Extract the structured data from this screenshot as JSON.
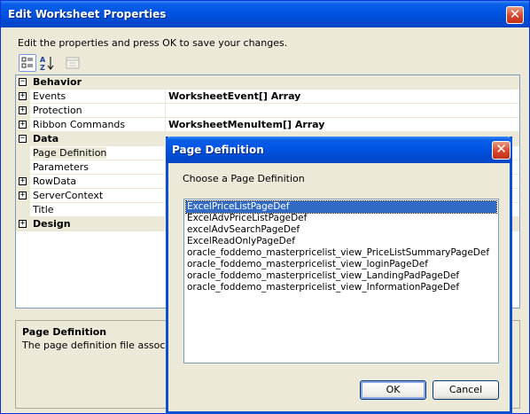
{
  "window": {
    "title": "Edit Worksheet Properties",
    "description": "Edit the properties and press OK to save your changes.",
    "close_glyph": "✕"
  },
  "toolbar": {
    "categorized_icon": "categorized-icon",
    "alphabetical_icon": "sort-alphabetical-icon",
    "property_pages_icon": "property-pages-icon"
  },
  "grid": {
    "rows": [
      {
        "kind": "category",
        "expander": "⊟",
        "name": "Behavior",
        "value": ""
      },
      {
        "kind": "property",
        "expander": "+",
        "name": "Events",
        "value": "WorksheetEvent[] Array"
      },
      {
        "kind": "property",
        "expander": "+",
        "name": "Protection",
        "value": ""
      },
      {
        "kind": "property",
        "expander": "+",
        "name": "Ribbon Commands",
        "value": "WorksheetMenuItem[] Array"
      },
      {
        "kind": "category",
        "expander": "⊟",
        "name": "Data",
        "value": ""
      },
      {
        "kind": "property",
        "expander": "",
        "name": "Page Definition",
        "value": ""
      },
      {
        "kind": "property",
        "expander": "",
        "name": "Parameters",
        "value": ""
      },
      {
        "kind": "property",
        "expander": "+",
        "name": "RowData",
        "value": ""
      },
      {
        "kind": "property",
        "expander": "+",
        "name": "ServerContext",
        "value": ""
      },
      {
        "kind": "property",
        "expander": "",
        "name": "Title",
        "value": ""
      },
      {
        "kind": "category",
        "expander": "+",
        "name": "Design",
        "value": ""
      }
    ]
  },
  "help": {
    "title": "Page Definition",
    "text": "The page definition file associated"
  },
  "dialog": {
    "title": "Page Definition",
    "prompt": "Choose a Page Definition",
    "items": [
      "ExcelPriceListPageDef",
      "ExcelAdvPriceListPageDef",
      "excelAdvSearchPageDef",
      "ExcelReadOnlyPageDef",
      "oracle_foddemo_masterpricelist_view_PriceListSummaryPageDef",
      "oracle_foddemo_masterpricelist_view_loginPageDef",
      "oracle_foddemo_masterpricelist_view_LandingPadPageDef",
      "oracle_foddemo_masterpricelist_view_InformationPageDef"
    ],
    "selected_index": 0,
    "ok_label": "OK",
    "cancel_label": "Cancel"
  },
  "colors": {
    "titlebar": "#0054e3",
    "selection": "#316ac5",
    "face": "#ece9d8",
    "close_button": "#d5462b"
  }
}
